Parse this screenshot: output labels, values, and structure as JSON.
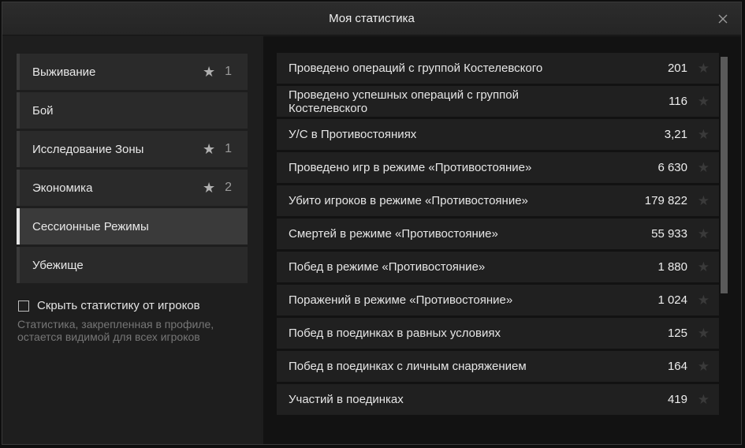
{
  "window": {
    "title": "Моя статистика"
  },
  "categories": [
    {
      "label": "Выживание",
      "stars": "1",
      "active": false
    },
    {
      "label": "Бой",
      "stars": "",
      "active": false
    },
    {
      "label": "Исследование Зоны",
      "stars": "1",
      "active": false
    },
    {
      "label": "Экономика",
      "stars": "2",
      "active": false
    },
    {
      "label": "Сессионные Режимы",
      "stars": "",
      "active": true
    },
    {
      "label": "Убежище",
      "stars": "",
      "active": false
    }
  ],
  "settings": {
    "hide_label": "Скрыть статистику от игроков",
    "hint": "Статистика, закрепленная в профиле, остается видимой для всех игроков",
    "hide_checked": false
  },
  "stats": [
    {
      "label": "Проведено операций с группой Костелевского",
      "value": "201"
    },
    {
      "label": "Проведено успешных операций с группой Костелевского",
      "value": "116"
    },
    {
      "label": "У/С в Противостояниях",
      "value": "3,21"
    },
    {
      "label": "Проведено игр в режиме «Противостояние»",
      "value": "6 630"
    },
    {
      "label": "Убито игроков в режиме «Противостояние»",
      "value": "179 822"
    },
    {
      "label": "Смертей в режиме «Противостояние»",
      "value": "55 933"
    },
    {
      "label": "Побед в режиме «Противостояние»",
      "value": "1 880"
    },
    {
      "label": "Поражений в режиме «Противостояние»",
      "value": "1 024"
    },
    {
      "label": "Побед в поединках в равных условиях",
      "value": "125"
    },
    {
      "label": "Побед в поединках с личным снаряжением",
      "value": "164"
    },
    {
      "label": "Участий в поединках",
      "value": "419"
    }
  ],
  "icons": {
    "close": "close-icon",
    "star": "star-icon"
  },
  "colors": {
    "active_accent": "#e6e6e6",
    "star_inactive": "#3a3a3a",
    "star_active": "#b0b0b0"
  }
}
